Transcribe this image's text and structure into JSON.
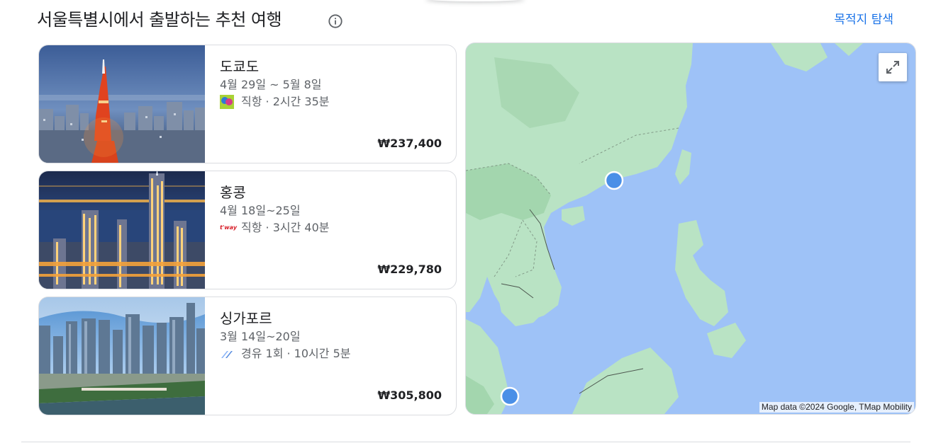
{
  "header": {
    "title": "서울특별시에서 출발하는 추천 여행",
    "info_icon": "info-icon",
    "explore_label": "목적지 탐색"
  },
  "destinations": [
    {
      "city": "도쿄도",
      "dates": "4월 29일 ~ 5월 8일",
      "flight": "직항 · 2시간 35분",
      "price": "₩237,400",
      "airline_icon": "airline-logo-icon"
    },
    {
      "city": "홍콩",
      "dates": "4월 18일~25일",
      "flight": "직항 · 3시간 40분",
      "price": "₩229,780",
      "airline_icon": "tway-logo-icon",
      "airline_logo_text": "t'way"
    },
    {
      "city": "싱가포르",
      "dates": "3월 14일~20일",
      "flight": "경유 1회 · 10시간 5분",
      "price": "₩305,800",
      "airline_icon": "multi-airline-icon"
    }
  ],
  "map": {
    "attribution": "Map data ©2024 Google, TMap Mobility",
    "expand_icon": "expand-icon",
    "markers": [
      "hong-kong-marker",
      "singapore-marker"
    ],
    "colors": {
      "water": "#9ec2f7",
      "land": "#b9e3c4",
      "land_dark": "#a3d6ae",
      "marker": "#4a8fe7"
    }
  }
}
